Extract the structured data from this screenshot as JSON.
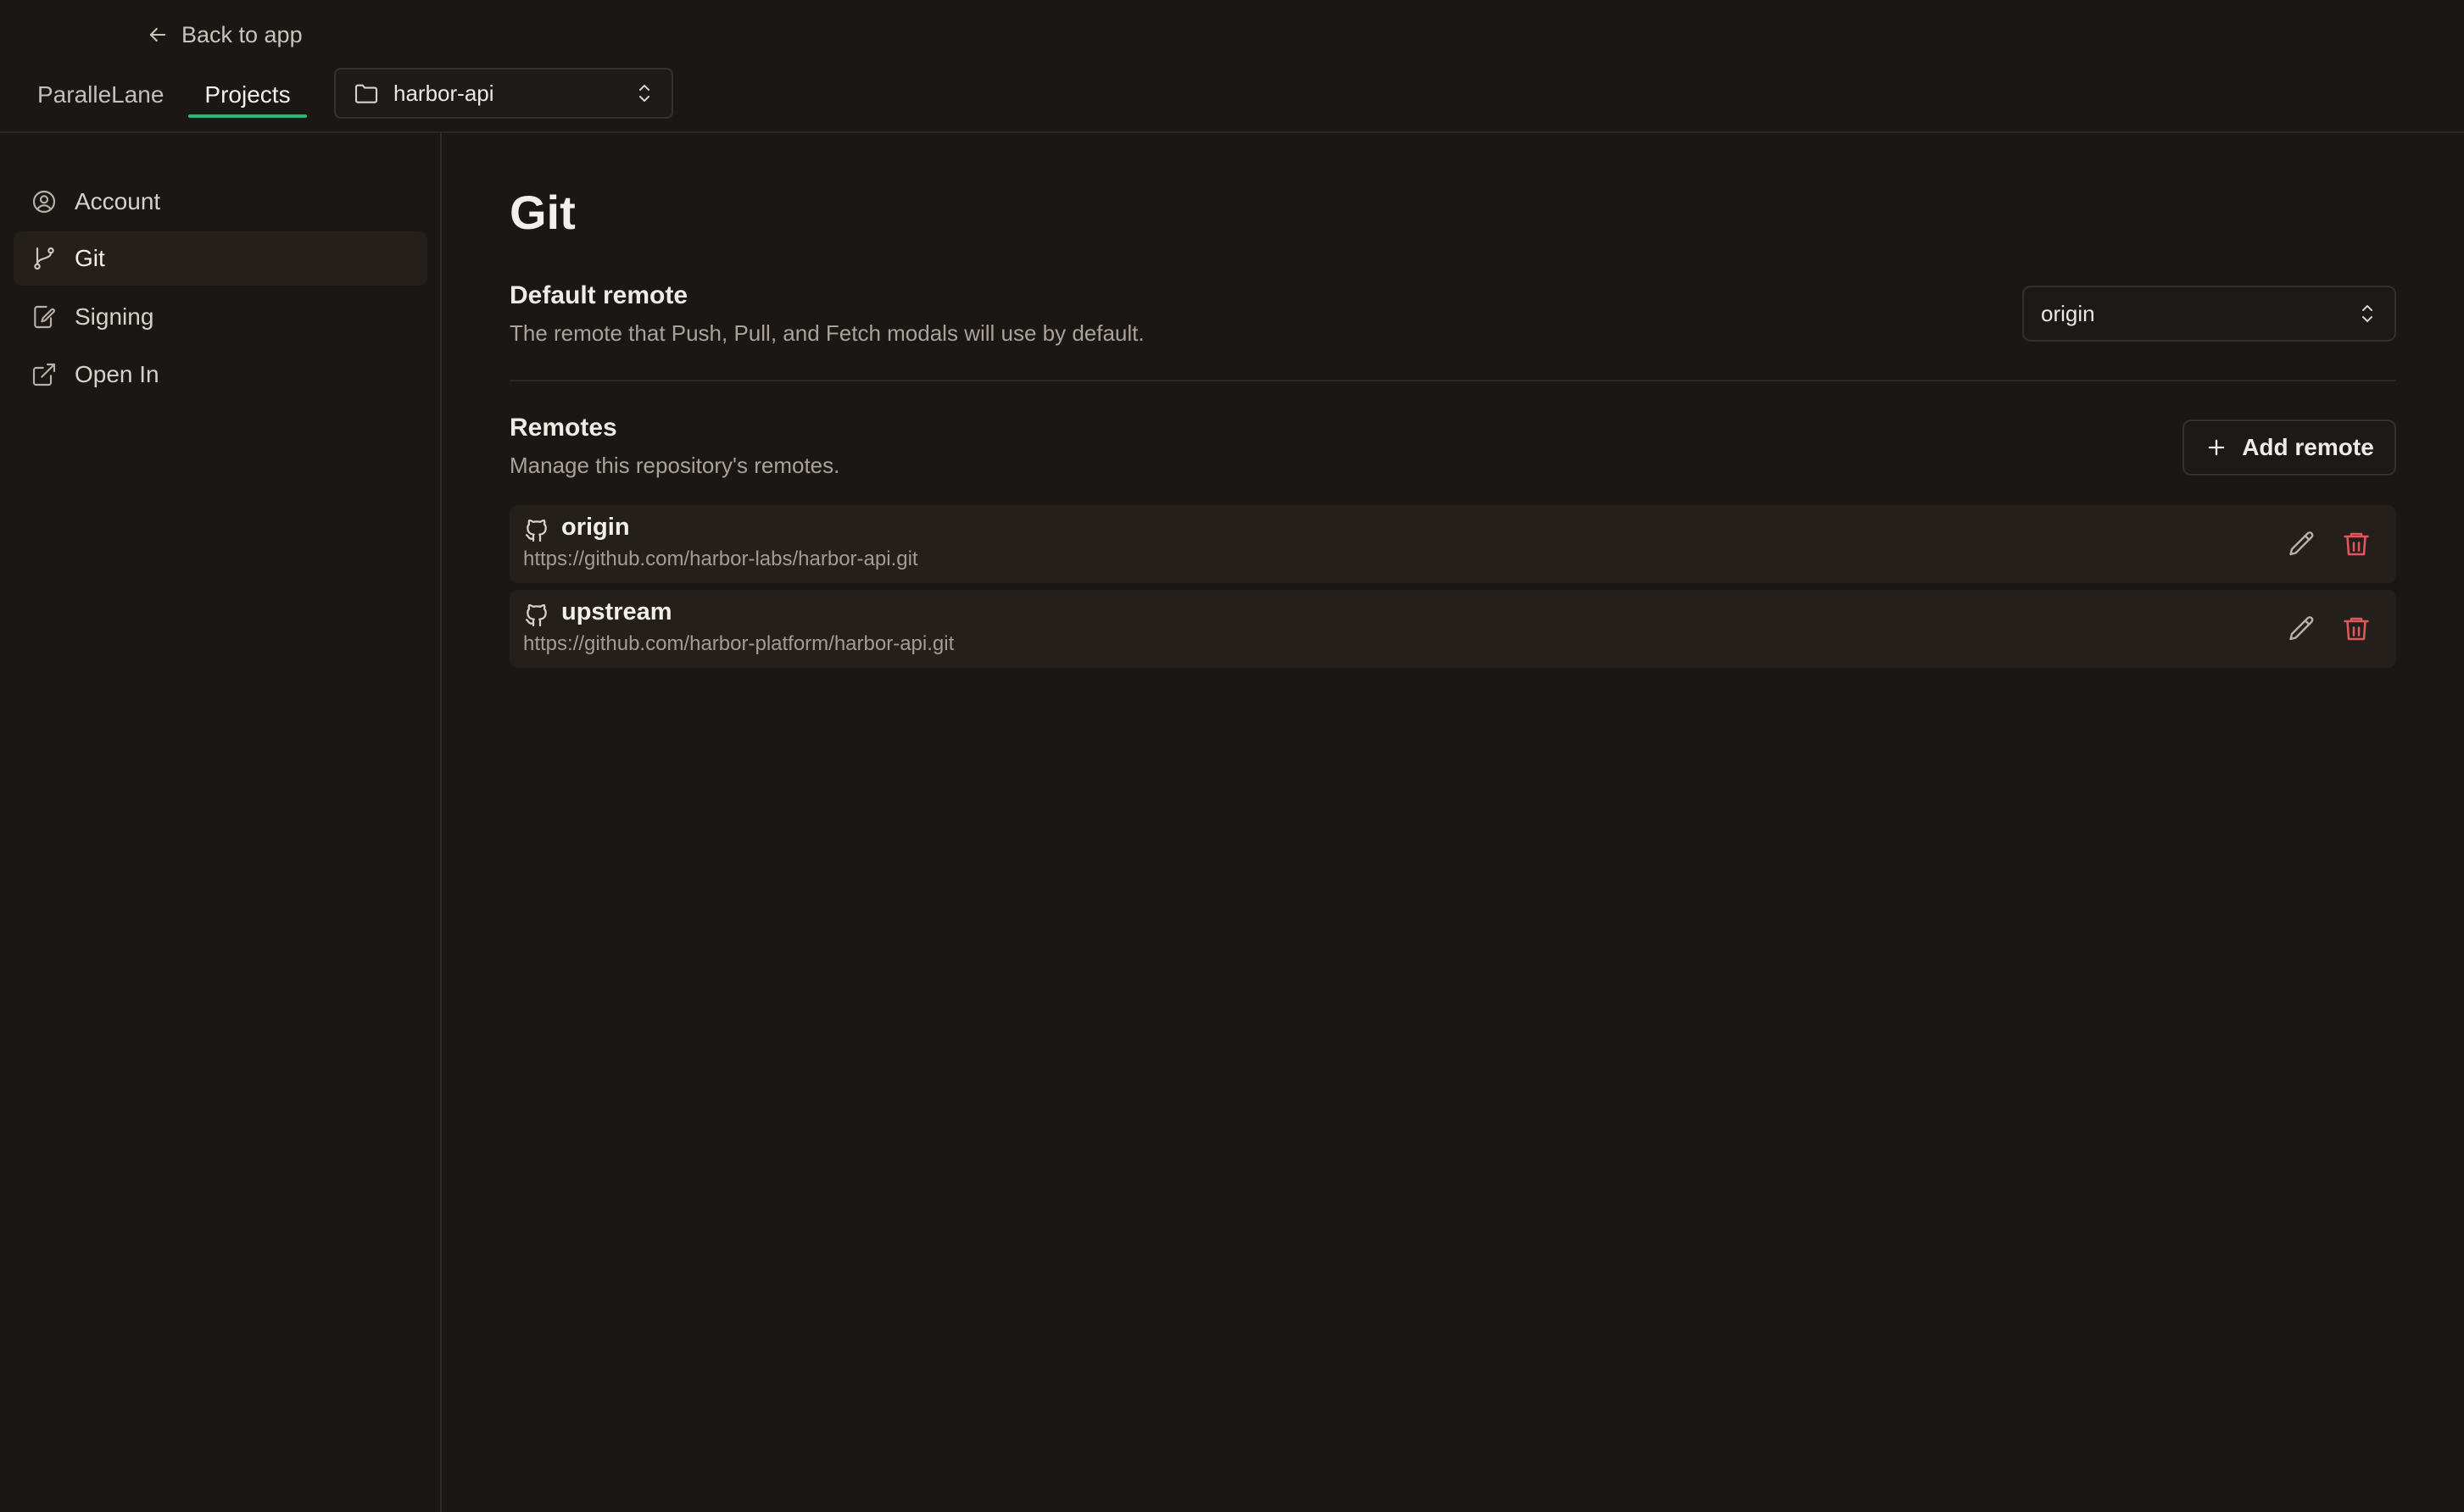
{
  "header": {
    "back_label": "Back to app",
    "tabs": [
      {
        "label": "ParalleLane",
        "active": false
      },
      {
        "label": "Projects",
        "active": true
      }
    ],
    "project_select": {
      "value": "harbor-api",
      "icon": "folder-icon"
    }
  },
  "sidebar": {
    "items": [
      {
        "label": "Account",
        "icon": "user-circle-icon",
        "active": false
      },
      {
        "label": "Git",
        "icon": "git-branch-icon",
        "active": true
      },
      {
        "label": "Signing",
        "icon": "signing-icon",
        "active": false
      },
      {
        "label": "Open In",
        "icon": "external-link-icon",
        "active": false
      }
    ]
  },
  "main": {
    "title": "Git",
    "default_remote": {
      "title": "Default remote",
      "description": "The remote that Push, Pull, and Fetch modals will use by default.",
      "value": "origin"
    },
    "remotes": {
      "title": "Remotes",
      "description": "Manage this repository's remotes.",
      "add_label": "Add remote",
      "items": [
        {
          "name": "origin",
          "url": "https://github.com/harbor-labs/harbor-api.git",
          "icon": "github-icon"
        },
        {
          "name": "upstream",
          "url": "https://github.com/harbor-platform/harbor-api.git",
          "icon": "github-icon"
        }
      ]
    }
  },
  "colors": {
    "background": "#1a1714",
    "accent": "#2bb673",
    "danger": "#e0585c"
  }
}
